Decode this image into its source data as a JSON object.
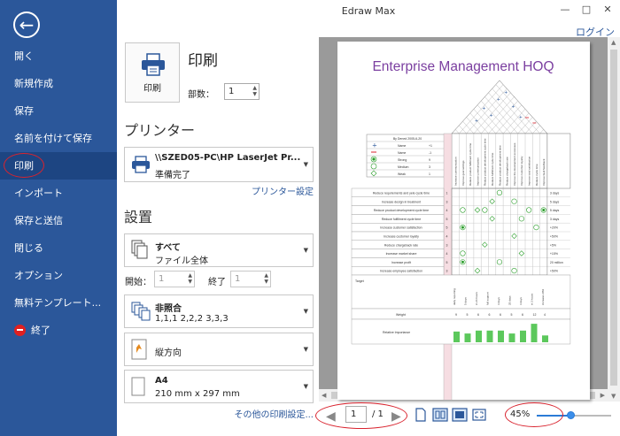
{
  "app": {
    "title": "Edraw Max",
    "login": "ログイン"
  },
  "sidebar": {
    "items": [
      {
        "label": "開く"
      },
      {
        "label": "新規作成"
      },
      {
        "label": "保存"
      },
      {
        "label": "名前を付けて保存"
      },
      {
        "label": "印刷",
        "active": true
      },
      {
        "label": "インポート"
      },
      {
        "label": "保存と送信"
      },
      {
        "label": "閉じる"
      },
      {
        "label": "オプション"
      },
      {
        "label": "無料テンプレート..."
      },
      {
        "label": "終了"
      }
    ]
  },
  "print": {
    "heading": "印刷",
    "button_label": "印刷",
    "copies_label": "部数：",
    "copies_value": "1"
  },
  "printer": {
    "heading": "プリンター",
    "name": "\\\\SZED05-PC\\HP LaserJet Pr...",
    "status": "準備完了",
    "settings_link": "プリンター設定"
  },
  "settings": {
    "heading": "設置",
    "range_main": "すべて",
    "range_sub": "ファイル全体",
    "start_label": "開始：",
    "start_value": "1",
    "end_label": "終了",
    "end_value": "1",
    "collate_main": "非照合",
    "collate_sub": "1,1,1   2,2,2   3,3,3",
    "orientation": "縦方向",
    "paper_main": "A4",
    "paper_sub": "210 mm x 297 mm",
    "other_link": "その他の印刷設定..."
  },
  "preview": {
    "title": "Enterprise Management HOQ",
    "legend": {
      "header": "By Dened  2005-6-20",
      "rows": [
        {
          "label": "Name",
          "value": "+1"
        },
        {
          "label": "Name",
          "value": "-1"
        },
        {
          "label": "Strong",
          "value": "9"
        },
        {
          "label": "Medium",
          "value": "3"
        },
        {
          "label": "Weak",
          "value": "1"
        }
      ]
    },
    "columns": [
      "Increase communication",
      "Improve goal settings",
      "Reduce product fulfilment cycle time",
      "Improve communication",
      "Reduce product development cycle time",
      "Reduce fulfilment cycle time",
      "Reduce product development time",
      "Reduce chargeback rate",
      "Improve the development processes",
      "Improve customer loyalty",
      "Improve total satisfaction",
      "Reduce cycle time",
      "Improve fault feedback"
    ],
    "requirements": [
      {
        "label": "Reduce requirements and yele cycle time",
        "weight": "1",
        "target": "3 days"
      },
      {
        "label": "Increase design in treatment",
        "weight": "3",
        "target": "5 days"
      },
      {
        "label": "Reduce product development cycle time",
        "weight": "4",
        "target": "5 days"
      },
      {
        "label": "Reduce fulfillment cycle time",
        "weight": "5",
        "target": "3 days"
      },
      {
        "label": "Increase customer satisfaction",
        "weight": "5",
        "target": "+20%"
      },
      {
        "label": "Increase customer loyalty",
        "weight": "4",
        "target": "+50%"
      },
      {
        "label": "Reduce chargeback rate",
        "weight": "3",
        "target": "+5%"
      },
      {
        "label": "Increase market share",
        "weight": "4",
        "target": "+15%"
      },
      {
        "label": "Increase profit",
        "weight": "5",
        "target": "20 million"
      },
      {
        "label": "Increase employee satisfaction",
        "weight": "3",
        "target": "+50%"
      }
    ],
    "target_label": "Target",
    "targets": [
      "daily reporting",
      "5 days",
      "in 24 hours",
      "full support",
      "3 days",
      "25 days",
      "3 days",
      "in 3 hours",
      "increase 20%"
    ],
    "weight_label": "Weight",
    "weights": [
      "9",
      "5",
      "6",
      "6",
      "6",
      "5",
      "6",
      "12",
      "4"
    ],
    "importance_label": "Relative Importance",
    "importance": [
      0.55,
      0.45,
      0.6,
      0.6,
      0.6,
      0.45,
      0.6,
      0.95,
      0.35
    ]
  },
  "pager": {
    "current": "1",
    "total": "/ 1"
  },
  "zoom": {
    "value": "45%",
    "level": 0.45
  },
  "colors": {
    "sidebar": "#2b579a",
    "active": "#1d4582",
    "accent": "#2b579a",
    "annotation": "#d9232e",
    "chart_bar": "#5cc85c"
  },
  "icons": [
    "back-arrow-icon",
    "printer-icon",
    "pages-icon",
    "collate-icon",
    "orientation-icon",
    "paper-icon",
    "exit-icon"
  ]
}
